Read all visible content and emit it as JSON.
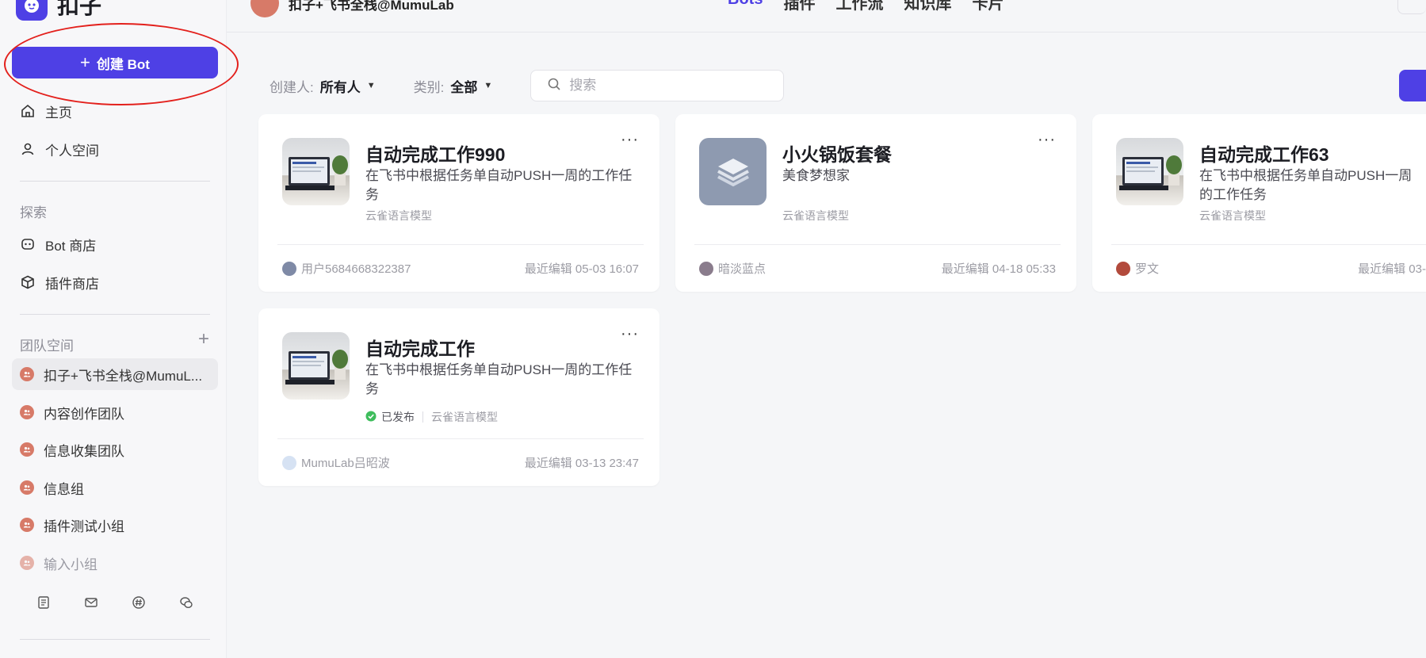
{
  "app": {
    "name": "扣子",
    "create_bot_label": "创建 Bot"
  },
  "sidebar": {
    "nav": [
      {
        "label": "主页",
        "icon": "home-icon"
      },
      {
        "label": "个人空间",
        "icon": "user-icon"
      }
    ],
    "explore_label": "探索",
    "explore_items": [
      {
        "label": "Bot 商店",
        "icon": "bot-icon"
      },
      {
        "label": "插件商店",
        "icon": "cube-icon"
      }
    ],
    "team_label": "团队空间",
    "teams": [
      "扣子+飞书全栈@MumuL...",
      "内容创作团队",
      "信息收集团队",
      "信息组",
      "插件测试小组",
      "输入小组"
    ]
  },
  "topbar": {
    "workspace_name": "扣子+飞书全栈@MumuLab",
    "tabs": [
      "Bots",
      "插件",
      "工作流",
      "知识库",
      "卡片"
    ]
  },
  "filters": {
    "creator_label": "创建人:",
    "creator_value": "所有人",
    "category_label": "类别:",
    "category_value": "全部",
    "search_placeholder": "搜索"
  },
  "cards": [
    {
      "title": "自动完成工作990",
      "description": "在飞书中根据任务单自动PUSH一周的工作任务",
      "model": "云雀语言模型",
      "owner": "用户5684668322387",
      "edited": "最近编辑 05-03 16:07"
    },
    {
      "title": "小火锅饭套餐",
      "description": "美食梦想家",
      "model": "云雀语言模型",
      "owner": "暗淡蓝点",
      "edited": "最近编辑 04-18 05:33"
    },
    {
      "title": "自动完成工作63",
      "description": "在飞书中根据任务单自动PUSH一周的工作任务",
      "model": "云雀语言模型",
      "owner": "罗文",
      "edited": "最近编辑 03-"
    },
    {
      "title": "自动完成工作",
      "description": "在飞书中根据任务单自动PUSH一周的工作任务",
      "status": "已发布",
      "model": "云雀语言模型",
      "owner": "MumuLab吕昭波",
      "edited": "最近编辑 03-13 23:47"
    }
  ],
  "colors": {
    "accent": "#4e40e5",
    "team_dot": "#d77a68",
    "annotation": "#e3201c",
    "published": "#3ebd5c"
  }
}
